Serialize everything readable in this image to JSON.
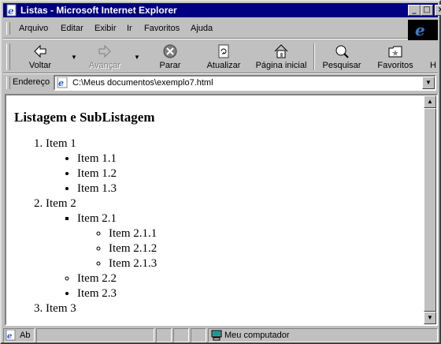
{
  "window": {
    "title": "Listas - Microsoft Internet Explorer"
  },
  "title_buttons": [
    "_",
    "□",
    "×"
  ],
  "menu": [
    "Arquivo",
    "Editar",
    "Exibir",
    "Ir",
    "Favoritos",
    "Ajuda"
  ],
  "toolbar": {
    "back": "Voltar",
    "forward": "Avançar",
    "stop": "Parar",
    "refresh": "Atualizar",
    "home": "Página inicial",
    "search": "Pesquisar",
    "favorites": "Favoritos"
  },
  "address": {
    "label": "Endereço",
    "value": "C:\\Meus documentos\\exemplo7.html"
  },
  "page": {
    "heading": "Listagem e SubListagem",
    "item1": "Item 1",
    "item1_1": "Item 1.1",
    "item1_2": "Item 1.2",
    "item1_3": "Item 1.3",
    "item2": "Item 2",
    "item2_1": "Item 2.1",
    "item2_1_1": "Item 2.1.1",
    "item2_1_2": "Item 2.1.2",
    "item2_1_3": "Item 2.1.3",
    "item2_2": "Item 2.2",
    "item2_3": "Item 2.3",
    "item3": "Item 3"
  },
  "status": {
    "text": "Ab",
    "zone": "Meu computador"
  },
  "colors": {
    "titlebar": "#000080",
    "face": "#c0c0c0",
    "ie_logo": "#3a7bd5"
  }
}
